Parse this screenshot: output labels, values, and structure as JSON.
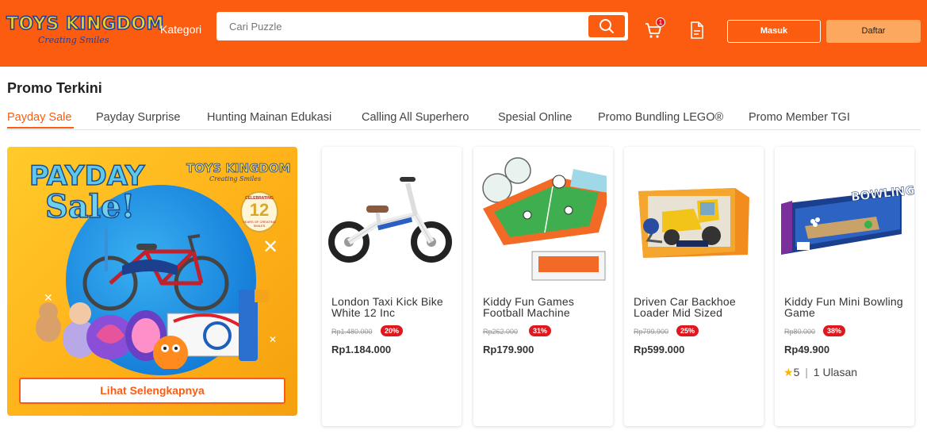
{
  "header": {
    "logo_text": "TOYS KINGDOM",
    "logo_tagline": "Creating Smiles",
    "category_label": "Kategori",
    "search_placeholder": "Cari Puzzle",
    "cart_count": "1",
    "login_label": "Masuk",
    "register_label": "Daftar"
  },
  "colors": {
    "brand": "#fb5c10",
    "discount": "#e0181e",
    "register_button": "#fca85e",
    "star": "#f5b50a"
  },
  "promo": {
    "title": "Promo Terkini",
    "tabs": [
      {
        "label": "Payday Sale",
        "active": true
      },
      {
        "label": "Payday Surprise"
      },
      {
        "label": "Hunting Mainan Edukasi"
      },
      {
        "label": "Calling All Superhero"
      },
      {
        "label": "Spesial Online"
      },
      {
        "label": "Promo Bundling LEGO®"
      },
      {
        "label": "Promo Member TGI"
      }
    ],
    "banner": {
      "headline_1": "PAYDAY",
      "headline_2": "Sale!",
      "logo_text": "TOYS KINGDOM",
      "logo_tagline": "Creating Smiles",
      "anniversary_top": "CELEBRATING",
      "anniversary_number": "12",
      "anniversary_bottom": "YEARS OF CREATING SMILES",
      "cta_label": "Lihat Selengkapnya"
    },
    "products": [
      {
        "name": "London Taxi Kick Bike White 12 Inc",
        "old_price": "Rp1.480.000",
        "discount": "20%",
        "price": "Rp1.184.000",
        "image_icon": "balance-bike-image"
      },
      {
        "name": "Kiddy Fun Games Football Machine",
        "old_price": "Rp262.000",
        "discount": "31%",
        "price": "Rp179.900",
        "image_icon": "football-table-image"
      },
      {
        "name": "Driven Car Backhoe Loader Mid Sized",
        "old_price": "Rp799.900",
        "discount": "25%",
        "price": "Rp599.000",
        "image_icon": "backhoe-loader-box-image"
      },
      {
        "name": "Kiddy Fun Mini Bowling Game",
        "old_price": "Rp80.000",
        "discount": "38%",
        "price": "Rp49.900",
        "image_icon": "bowling-game-box-image",
        "rating": "5",
        "reviews": "1 Ulasan"
      }
    ]
  }
}
